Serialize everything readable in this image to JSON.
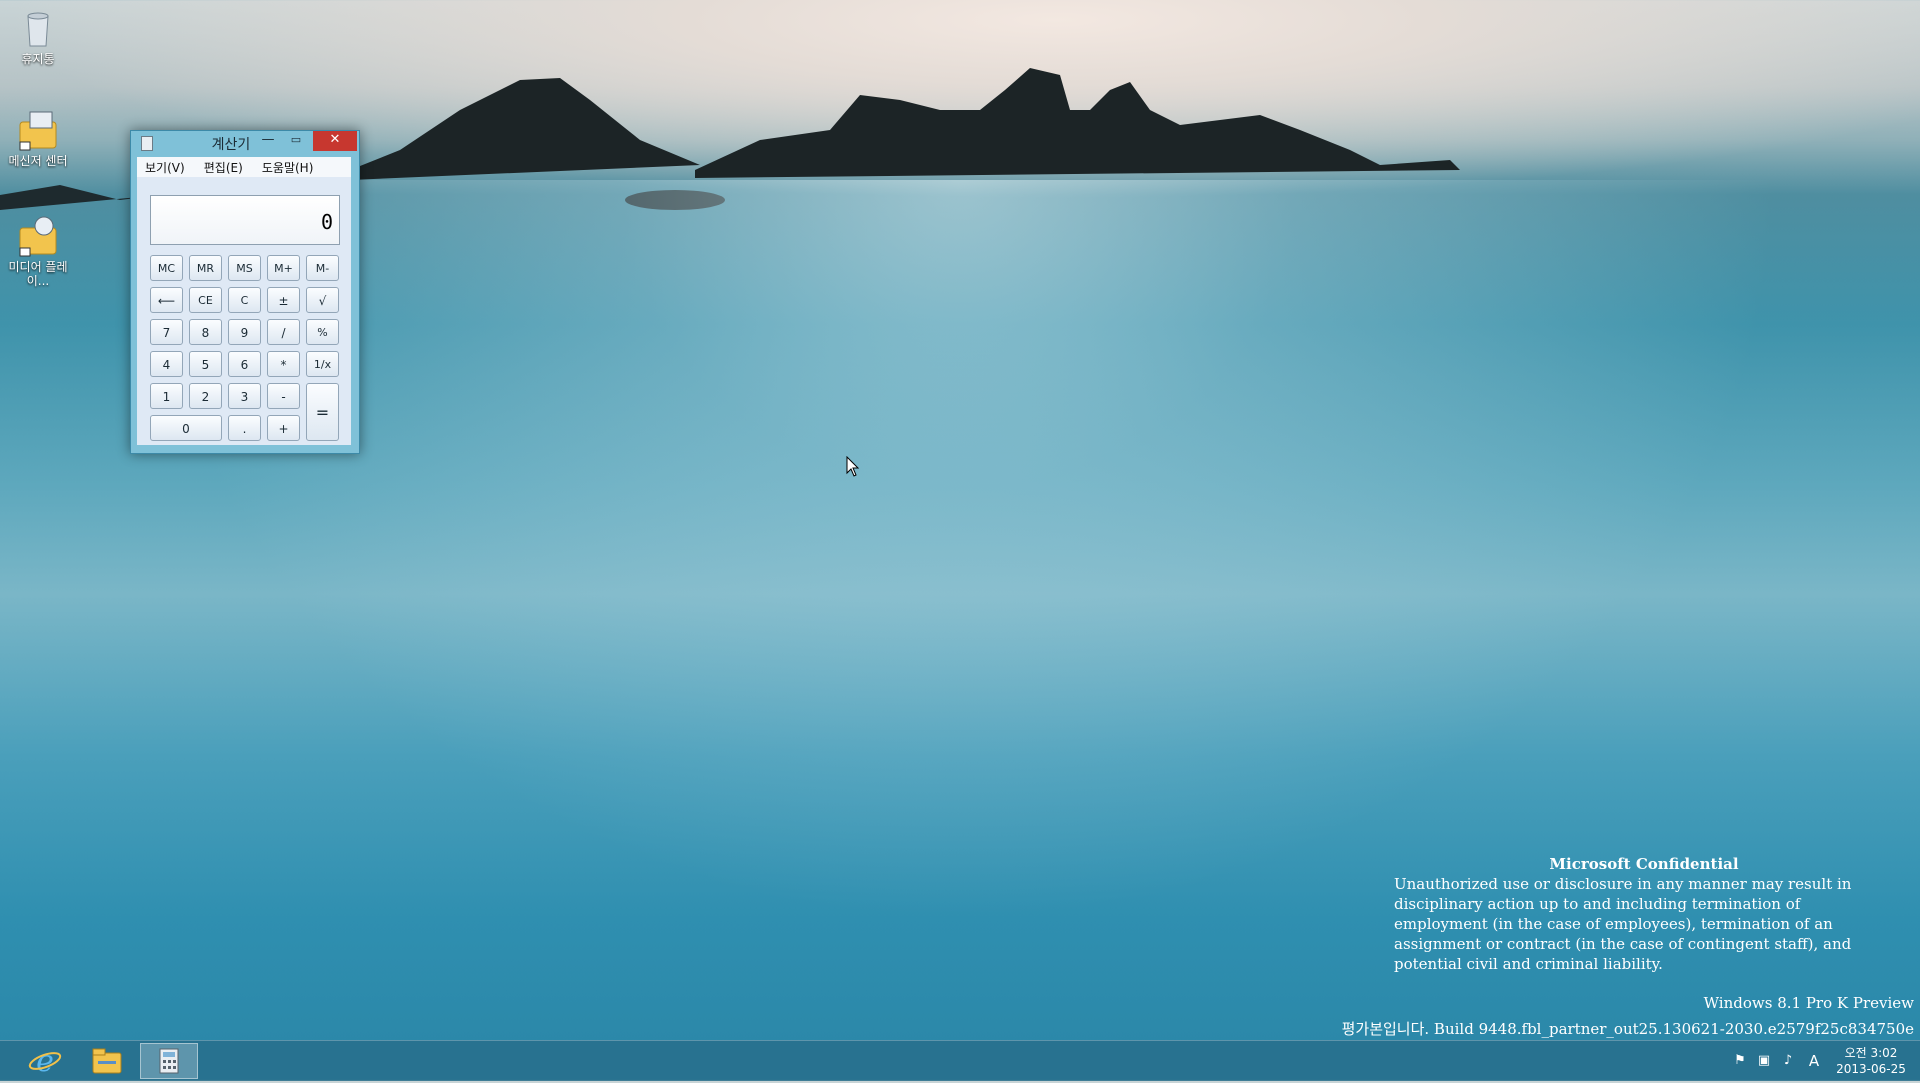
{
  "desktop": {
    "icons": [
      {
        "label": "휴지통",
        "icon": "recycle-bin-icon"
      },
      {
        "label": "메신저 센터",
        "icon": "messenger-folder-icon"
      },
      {
        "label": "미디어 플레이...",
        "icon": "media-player-folder-icon"
      }
    ]
  },
  "calculator": {
    "title": "계산기",
    "menu": [
      "보기(V)",
      "편집(E)",
      "도움말(H)"
    ],
    "display": "0",
    "buttons": {
      "mc": "MC",
      "mr": "MR",
      "ms": "MS",
      "mplus": "M+",
      "mminus": "M-",
      "back": "⟵",
      "ce": "CE",
      "c": "C",
      "pm": "±",
      "sqrt": "√",
      "n7": "7",
      "n8": "8",
      "n9": "9",
      "div": "/",
      "pct": "%",
      "n4": "4",
      "n5": "5",
      "n6": "6",
      "mul": "*",
      "inv": "1/x",
      "n1": "1",
      "n2": "2",
      "n3": "3",
      "sub": "-",
      "eq": "=",
      "n0": "0",
      "dot": ".",
      "add": "+"
    }
  },
  "watermark": {
    "title": "Microsoft Confidential",
    "body": "Unauthorized use or disclosure in any manner may result in disciplinary action up to and including termination of employment (in the case of employees), termination of an assignment or contract (in the case of contingent staff), and potential civil and criminal liability.",
    "edition": "Windows 8.1 Pro K Preview",
    "build": "평가본입니다. Build 9448.fbl_partner_out25.130621-2030.e2579f25c834750e"
  },
  "taskbar": {
    "apps": [
      "internet-explorer-icon",
      "file-explorer-icon",
      "calculator-icon"
    ],
    "clock_time": "오전 3:02",
    "clock_date": "2013-06-25",
    "ime": "A"
  }
}
